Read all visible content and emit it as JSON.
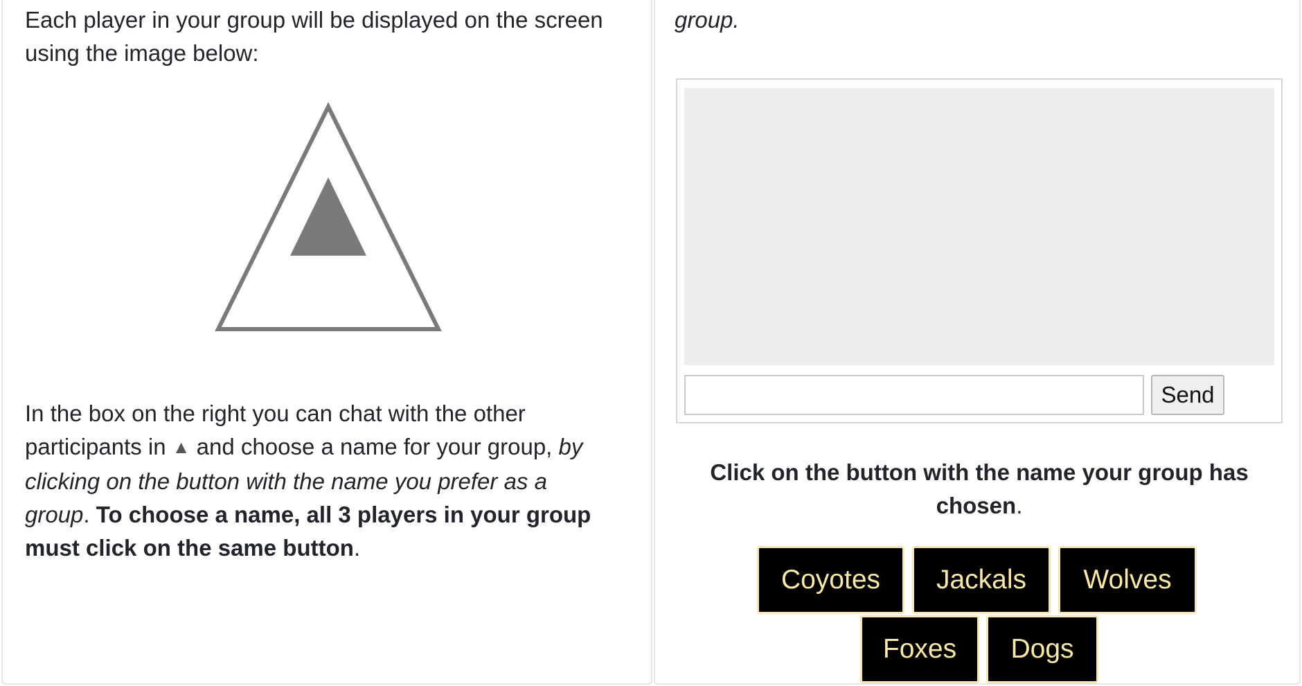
{
  "left": {
    "intro": "Each player in your group will be displayed on the screen using the image below:",
    "instructions": {
      "part1": "In the box on the right you can chat with the other participants in ",
      "group_symbol": "▲",
      "part2": " and choose a name for your group, ",
      "italic": "by clicking on the button with the name you prefer as a group",
      "sep": ". ",
      "bold": "To choose a name, all 3 players in your group must click on the same button",
      "end": "."
    }
  },
  "right": {
    "top_text": "group.",
    "chat": {
      "input_value": "",
      "send_label": "Send"
    },
    "prompt": {
      "bold": "Click on the button with the name your group has chosen",
      "end": "."
    },
    "name_buttons": [
      "Coyotes",
      "Jackals",
      "Wolves",
      "Foxes",
      "Dogs"
    ]
  },
  "colors": {
    "icon_gray": "#7a7a7a",
    "button_bg": "#000000",
    "button_text": "#fde9a8",
    "chat_log_bg": "#eeeeee"
  },
  "icons": {
    "player_image": "triangle-in-triangle-icon"
  }
}
